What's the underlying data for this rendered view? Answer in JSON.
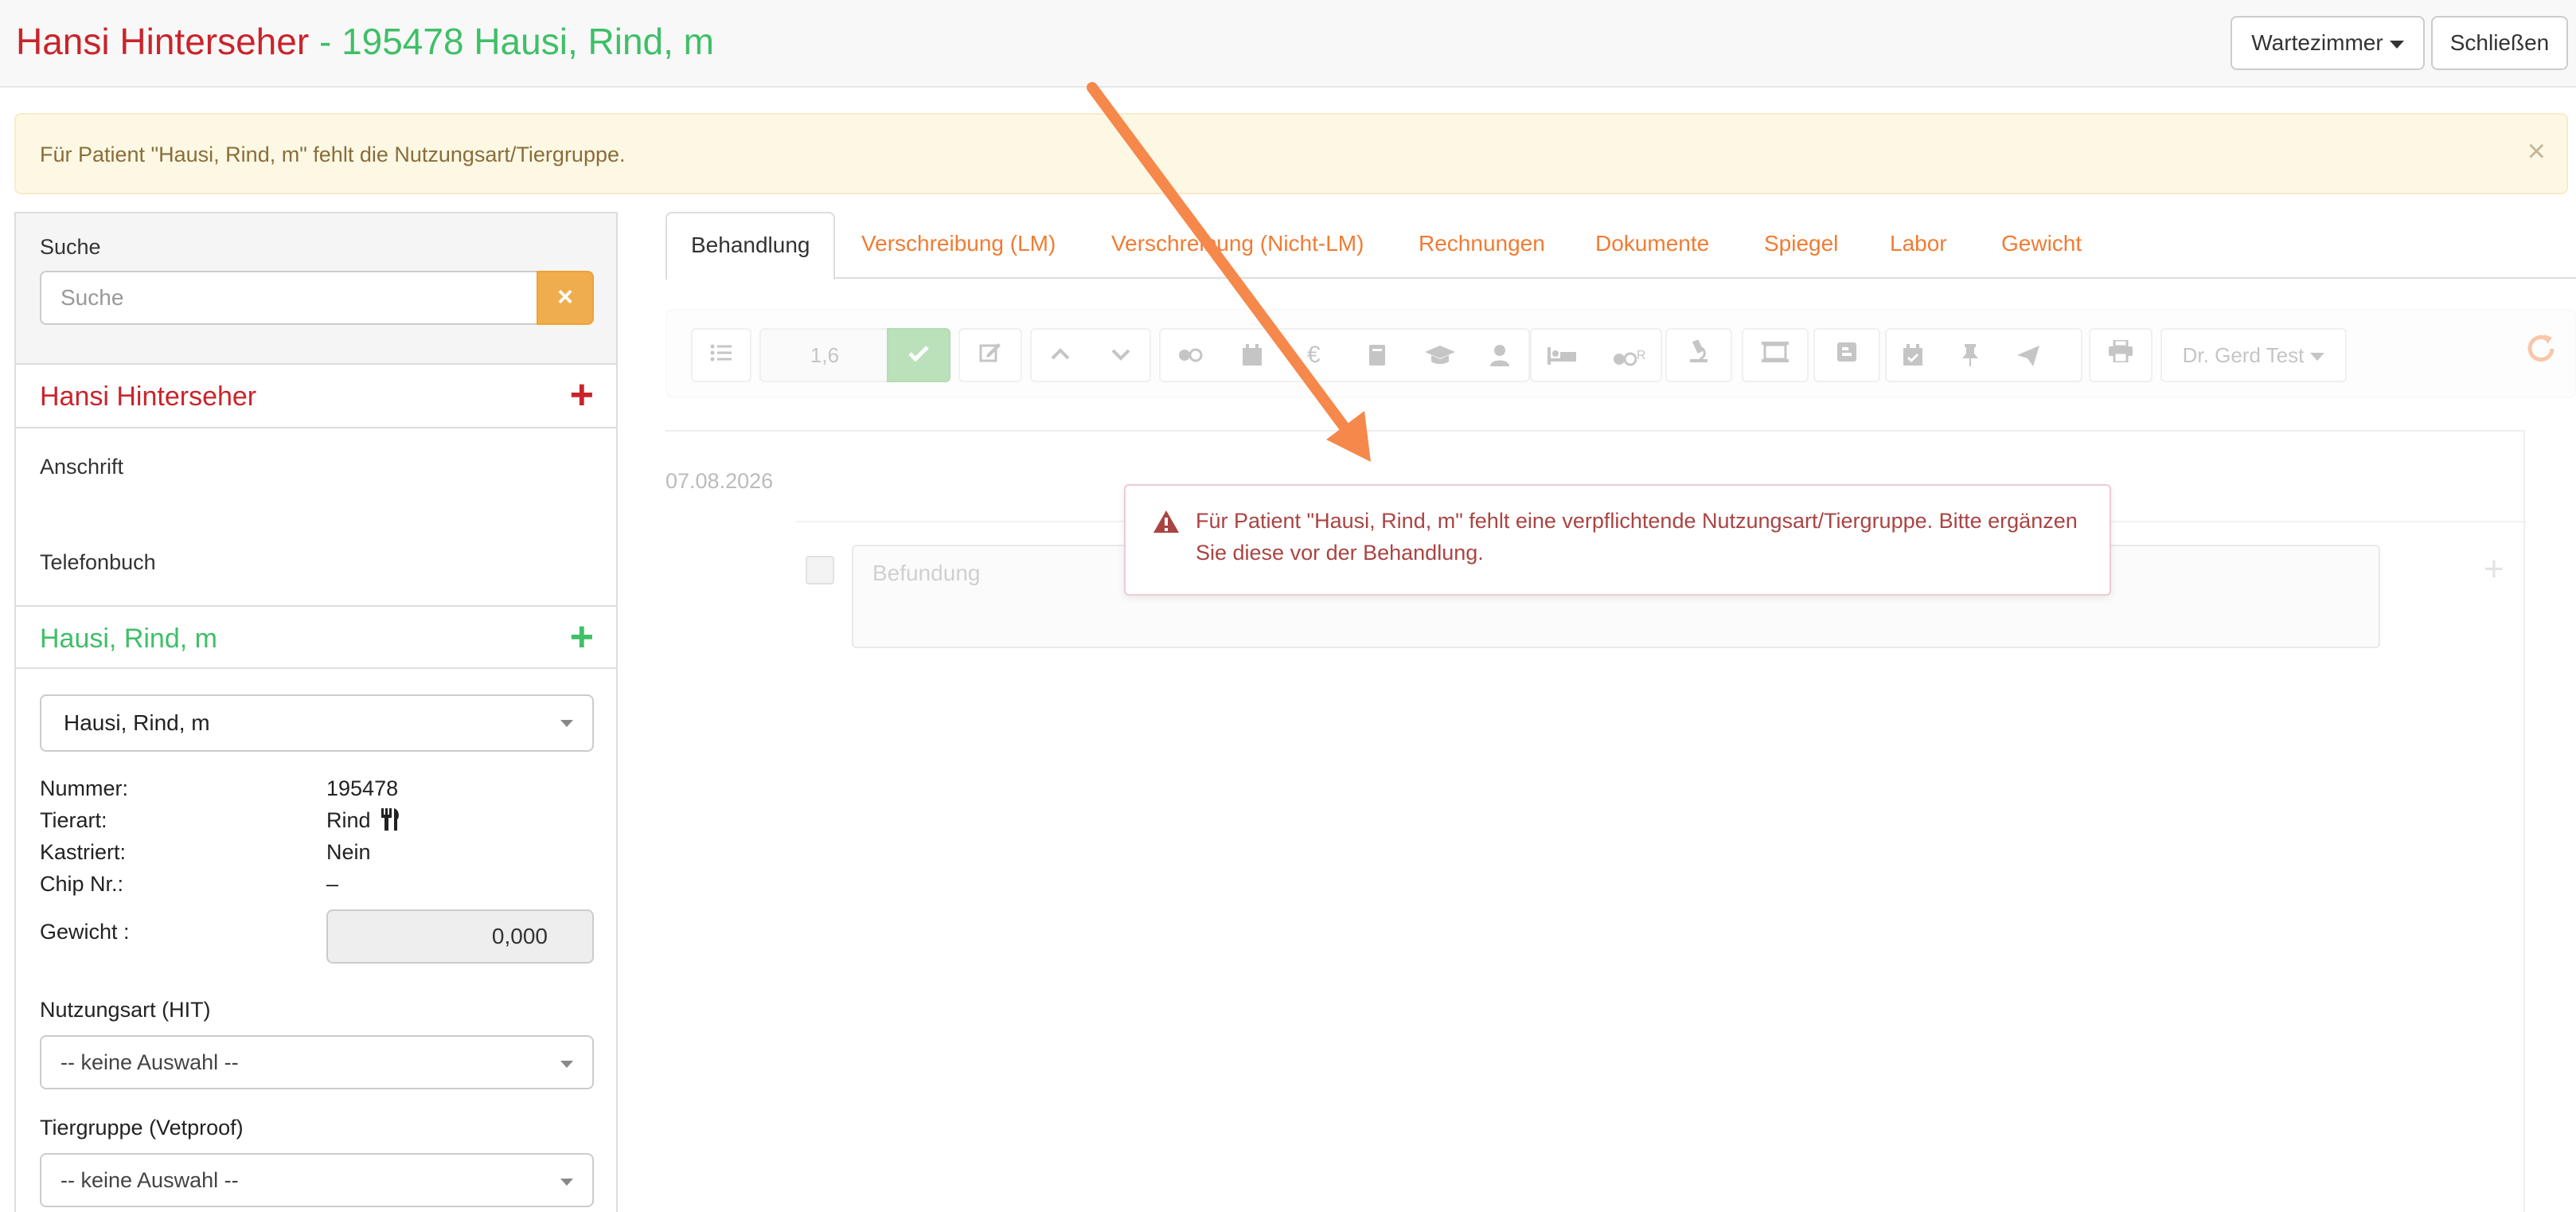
{
  "header": {
    "owner_name": "Hansi Hinterseher",
    "separator": " - ",
    "patient_title": "195478 Hausi, Rind, m",
    "waiting_room_label": "Wartezimmer",
    "close_label": "Schließen"
  },
  "banner": {
    "text": "Für Patient \"Hausi, Rind, m\" fehlt die Nutzungsart/Tiergruppe.",
    "close_symbol": "×"
  },
  "sidebar": {
    "search_label": "Suche",
    "search_placeholder": "Suche",
    "search_clear_symbol": "×",
    "owner_name": "Hansi Hinterseher",
    "add_symbol": "+",
    "address_label": "Anschrift",
    "phonebook_label": "Telefonbuch",
    "patient_name": "Hausi, Rind, m",
    "patient_select_value": "Hausi, Rind, m",
    "details": {
      "number_label": "Nummer:",
      "number_value": "195478",
      "species_label": "Tierart:",
      "species_value": "Rind",
      "species_icon": "utensils-icon",
      "castrated_label": "Kastriert:",
      "castrated_value": "Nein",
      "chip_label": "Chip Nr.:",
      "chip_value": "–",
      "weight_label": "Gewicht :",
      "weight_value": "0,000"
    },
    "usage_label": "Nutzungsart (HIT)",
    "usage_value": "-- keine Auswahl --",
    "group_label": "Tiergruppe (Vetproof)",
    "group_value": "-- keine Auswahl --"
  },
  "tabs": [
    {
      "label": "Behandlung",
      "active": true
    },
    {
      "label": "Verschreibung (LM)"
    },
    {
      "label": "Verschreibung (Nicht-LM)"
    },
    {
      "label": "Rechnungen"
    },
    {
      "label": "Dokumente"
    },
    {
      "label": "Spiegel"
    },
    {
      "label": "Labor"
    },
    {
      "label": "Gewicht"
    }
  ],
  "toolbar": {
    "factor_value": "1,6",
    "doctor_label": "Dr. Gerd Test",
    "icons": [
      "list-icon",
      "check-icon",
      "edit-icon",
      "chevron-up-icon",
      "chevron-down-icon",
      "pills-icon",
      "calendar-icon",
      "euro-icon",
      "book-icon",
      "graduation-cap-icon",
      "user-icon",
      "bed-icon",
      "pills-r-icon",
      "microscope-icon",
      "monitor-icon",
      "form-icon",
      "calendar-check-icon",
      "pin-icon",
      "send-icon",
      "print-icon",
      "refresh-icon"
    ],
    "euro_symbol": "€",
    "pills_r_suffix": "R"
  },
  "content": {
    "date": "07.08.2026",
    "befund_placeholder": "Befundung",
    "add_symbol": "+"
  },
  "error_toast": {
    "icon": "warning-icon",
    "text": "Für Patient \"Hausi, Rind, m\" fehlt eine verpflichtende Nutzungsart/Tiergruppe. Bitte ergänzen Sie diese vor der Behandlung."
  },
  "annotation": {
    "arrow_color": "#f5884a"
  },
  "colors": {
    "owner": "#c9242b",
    "patient": "#3fbf68",
    "tab_link": "#f07c34",
    "warning_bg": "#fcf8e3",
    "warning_text": "#8a6d3b",
    "error_text": "#a94442"
  }
}
